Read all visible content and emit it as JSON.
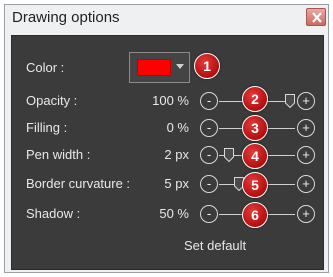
{
  "window": {
    "title": "Drawing options",
    "close_icon": "x-icon"
  },
  "colors": {
    "panel": "#3b3b3b",
    "selected_color": "#ff0000",
    "badge": "#c41a1a"
  },
  "color_row": {
    "label": "Color :",
    "badge": "1"
  },
  "rows": [
    {
      "label": "Opacity :",
      "value": "100 %",
      "badge": "2",
      "level": 1.0
    },
    {
      "label": "Filling :",
      "value": "0 %",
      "badge": "3",
      "level": 0.0
    },
    {
      "label": "Pen width :",
      "value": "2 px",
      "badge": "4",
      "level": 0.1
    },
    {
      "label": "Border curvature :",
      "value": "5 px",
      "badge": "5",
      "level": 0.25
    },
    {
      "label": "Shadow :",
      "value": "50 %",
      "badge": "6",
      "level": 0.5
    }
  ],
  "buttons": {
    "minus": "-",
    "plus": "+"
  },
  "set_default_label": "Set default"
}
